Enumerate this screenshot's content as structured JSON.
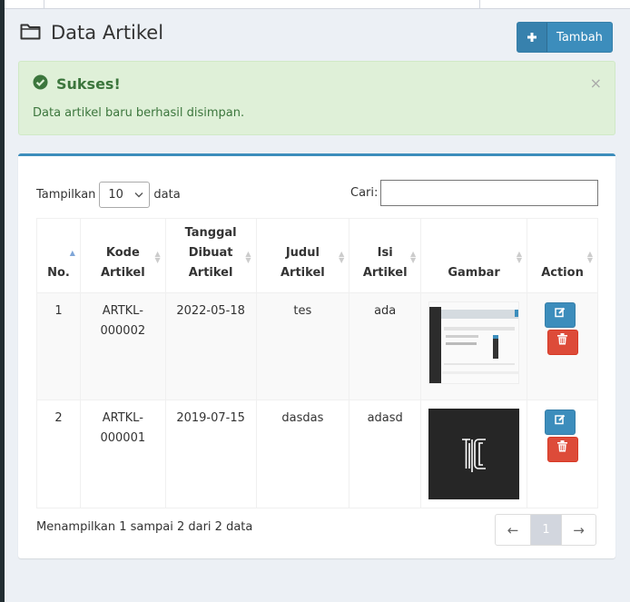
{
  "header": {
    "title": "Data Artikel",
    "add_button": "Tambah"
  },
  "alert": {
    "title": "Sukses!",
    "message": "Data artikel baru berhasil disimpan.",
    "close": "×"
  },
  "table_controls": {
    "show_prefix": "Tampilkan",
    "page_length": "10",
    "show_suffix": "data",
    "search_label": "Cari:",
    "search_value": ""
  },
  "columns": [
    {
      "lines": [
        "No."
      ]
    },
    {
      "lines": [
        "Kode",
        "Artikel"
      ]
    },
    {
      "lines": [
        "Tanggal",
        "Dibuat",
        "Artikel"
      ]
    },
    {
      "lines": [
        "Judul Artikel"
      ]
    },
    {
      "lines": [
        "Isi",
        "Artikel"
      ]
    },
    {
      "lines": [
        "Gambar"
      ]
    },
    {
      "lines": [
        "Action"
      ]
    }
  ],
  "rows": [
    {
      "no": "1",
      "kode": [
        "ARTKL-",
        "000002"
      ],
      "tanggal": "2022-05-18",
      "judul": "tes",
      "isi": "ada"
    },
    {
      "no": "2",
      "kode": [
        "ARTKL-",
        "000001"
      ],
      "tanggal": "2019-07-15",
      "judul": "dasdas",
      "isi": "adasd"
    }
  ],
  "footer": {
    "info": "Menampilkan 1 sampai 2 dari 2 data",
    "prev": "←",
    "current_page": "1",
    "next": "→"
  },
  "icons": {
    "title": "folder-open-icon",
    "add": "plus-icon",
    "alert": "check-circle-icon",
    "edit": "edit-icon",
    "delete": "trash-icon"
  },
  "colors": {
    "primary": "#3c8dbc",
    "success_bg": "#dff0d8",
    "success_text": "#3c763d",
    "danger": "#dd4b39"
  }
}
